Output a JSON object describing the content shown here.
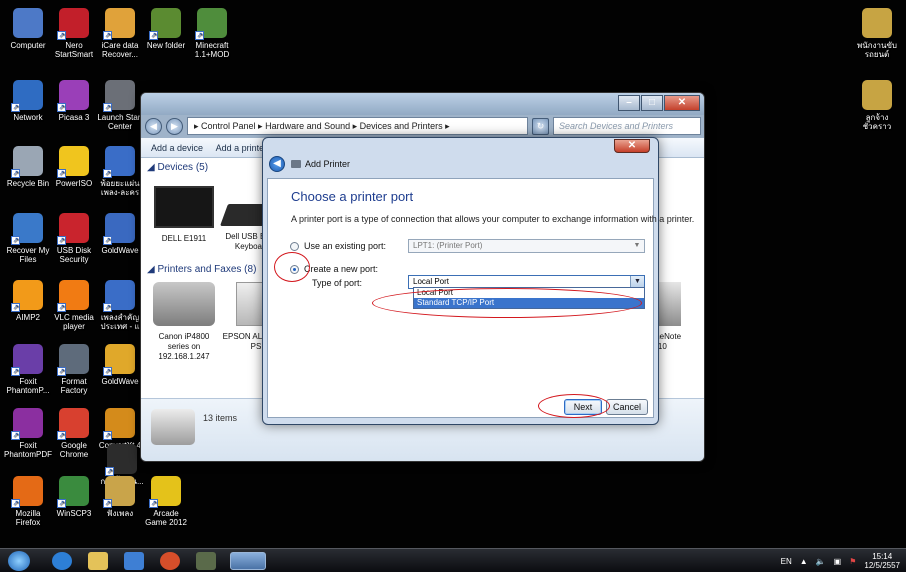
{
  "desktop": {
    "icons": [
      {
        "label": "Computer",
        "icon": "computer-icon",
        "color": "#4d79c7"
      },
      {
        "label": "Nero StartSmart",
        "icon": "nero-icon",
        "color": "#c21f2a"
      },
      {
        "label": "iCare data Recover...",
        "icon": "icare-icon",
        "color": "#e0a23a"
      },
      {
        "label": "New folder",
        "icon": "folder-icon",
        "color": "#5b8b31"
      },
      {
        "label": "Minecraft 1.1+MOD",
        "icon": "minecraft-icon",
        "color": "#4f8d3c"
      },
      {
        "label": "Network",
        "icon": "network-icon",
        "color": "#2f6cc2"
      },
      {
        "label": "Picasa 3",
        "icon": "picasa-icon",
        "color": "#9a3fb8"
      },
      {
        "label": "Launch Start Center",
        "icon": "launch-icon",
        "color": "#6b6f77"
      },
      {
        "label": "Recycle Bin",
        "icon": "recycle-bin-icon",
        "color": "#9aa6b4"
      },
      {
        "label": "PowerISO",
        "icon": "poweriso-icon",
        "color": "#f0c51e"
      },
      {
        "label": "พ้อยยะแผ่นเพลง-ละคร",
        "icon": "document-icon",
        "color": "#3a6dc7"
      },
      {
        "label": "Recover My Files",
        "icon": "recover-icon",
        "color": "#3a79c9"
      },
      {
        "label": "USB Disk Security",
        "icon": "shield-icon",
        "color": "#c9242d"
      },
      {
        "label": "GoldWave",
        "icon": "goldwave-icon",
        "color": "#3a69c0"
      },
      {
        "label": "AIMP2",
        "icon": "aimp-icon",
        "color": "#f29a19"
      },
      {
        "label": "VLC media player",
        "icon": "vlc-icon",
        "color": "#f17b13"
      },
      {
        "label": "เพลงสำคัญประเทศ - แ",
        "icon": "document-icon",
        "color": "#3a6dc7"
      },
      {
        "label": "Foxit PhantomP...",
        "icon": "foxit-icon",
        "color": "#6a3ea8"
      },
      {
        "label": "Format Factory",
        "icon": "format-factory-icon",
        "color": "#5e6b7b"
      },
      {
        "label": "GoldWave",
        "icon": "goldwave-icon",
        "color": "#e0a82a"
      },
      {
        "label": "Foxit PhantomPDF",
        "icon": "foxit-pdf-icon",
        "color": "#8b2fa0"
      },
      {
        "label": "Google Chrome",
        "icon": "chrome-icon",
        "color": "#d8402f"
      },
      {
        "label": "ConvertXt 4",
        "icon": "convertx-icon",
        "color": "#d48b1b"
      },
      {
        "label": "การตั้งงาน...",
        "icon": "shortcut-icon",
        "color": "#2c2c2c"
      },
      {
        "label": "Mozilla Firefox",
        "icon": "firefox-icon",
        "color": "#e46a16"
      },
      {
        "label": "WinSCP3",
        "icon": "winscp-icon",
        "color": "#3a8b3e"
      },
      {
        "label": "ฟังเพลง",
        "icon": "folder-icon",
        "color": "#c9a44a"
      },
      {
        "label": "Arcade Game 2012",
        "icon": "arcade-icon",
        "color": "#e4c21a"
      }
    ],
    "right_icons": [
      {
        "label": "พนักงานขับรถยนต์",
        "icon": "book-icon",
        "color": "#c7a443"
      },
      {
        "label": "ลูกจ้างชั่วคราว",
        "icon": "book-icon",
        "color": "#c7a443"
      }
    ]
  },
  "devices_window": {
    "breadcrumb": "▸ Control Panel ▸ Hardware and Sound ▸ Devices and Printers ▸",
    "search_placeholder": "Search Devices and Printers",
    "cmd_add_device": "Add a device",
    "cmd_add_printer": "Add a printer",
    "devices_header": "Devices (5)",
    "printers_header": "Printers and Faxes (8)",
    "devices": [
      {
        "label": "DELL E1911"
      },
      {
        "label": "Dell USB Entry Keyboard"
      }
    ],
    "printers": [
      {
        "label": "Canon iP4800 series on 192.168.1.247"
      },
      {
        "label": "EPSON AL-M2000 PS"
      },
      {
        "label": "OneNote 2010"
      }
    ],
    "items_count": "13 items"
  },
  "dialog": {
    "title": "Add Printer",
    "heading": "Choose a printer port",
    "description": "A printer port is a type of connection that allows your computer to exchange information with a printer.",
    "opt_existing": "Use an existing port:",
    "existing_value": "LPT1: (Printer Port)",
    "opt_new": "Create a new port:",
    "type_label": "Type of port:",
    "type_value": "Local Port",
    "type_options": [
      "Local Port",
      "Standard TCP/IP Port"
    ],
    "next_label": "Next",
    "cancel_label": "Cancel"
  },
  "taskbar": {
    "lang": "EN",
    "time": "15:14",
    "date": "12/5/2557"
  }
}
